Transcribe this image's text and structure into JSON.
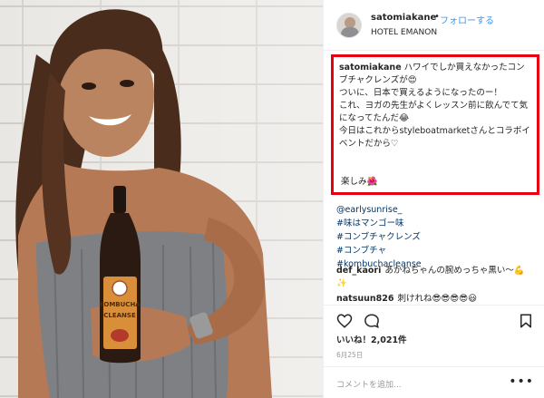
{
  "post": {
    "username": "satomiakane",
    "separator": "•",
    "follow_label": "フォローする",
    "location": "HOTEL EMANON"
  },
  "caption": {
    "username": "satomiakane",
    "lines": [
      "ハワイでしか買えなかったコンブチャクレンズが😍",
      "ついに、日本で買えるようになったのー！",
      "これ、ヨガの先生がよくレッスン前に飲んでて気になってたんだ😂",
      "今日はこれからstyleboatmarketさんとコラボイベントだから♡"
    ],
    "tail": "楽しみ🌺",
    "highlight_color": "#e60012"
  },
  "tags": [
    "@earlysunrise_",
    "#味はマンゴー味",
    "#コンブチャクレンズ",
    "#コンブチャ",
    "#kombuchacleanse"
  ],
  "comments": [
    {
      "user": "def_kaori",
      "text": "あかねちゃんの腕めっちゃ黒い〜💪",
      "continuation": "✨"
    },
    {
      "user": "natsuun826",
      "text": "刺けれね😎😎😎😎😃"
    }
  ],
  "likes": "いいね！2,021件",
  "date": "6月25日",
  "add_comment_placeholder": "コメントを追加...",
  "more_label": "•••",
  "bottle": {
    "label_top": "KOMBUCHA",
    "label_bottom": "CLEANSE"
  },
  "icons": {
    "heart": "heart-icon",
    "comment": "comment-icon",
    "bookmark": "bookmark-icon"
  }
}
